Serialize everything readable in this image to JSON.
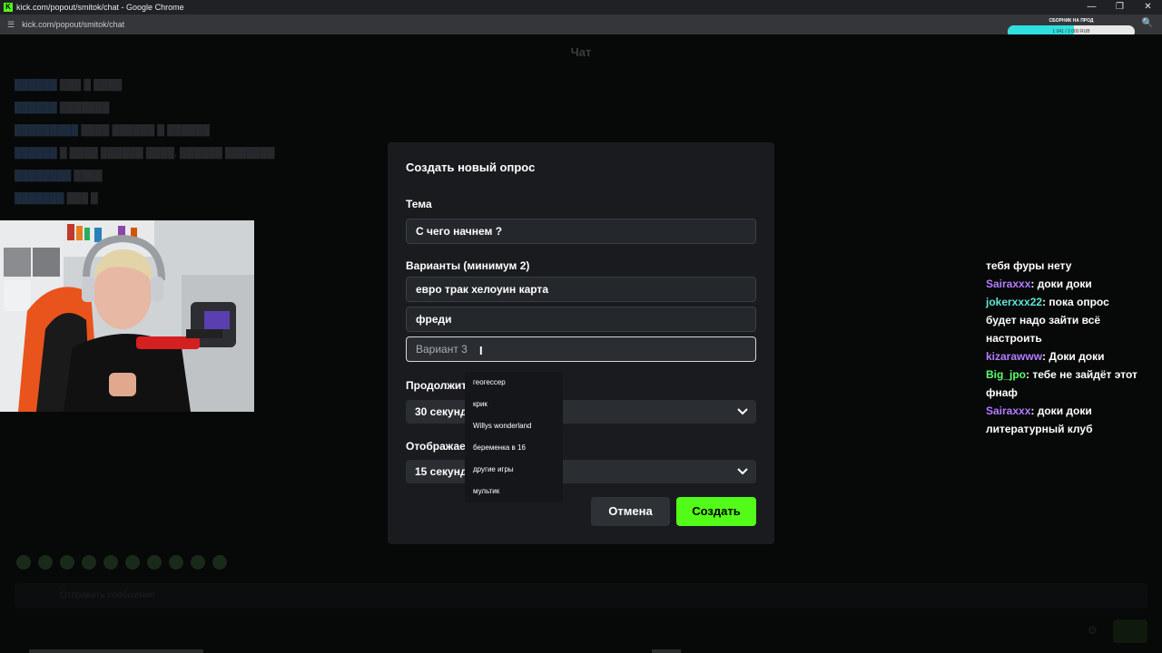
{
  "browser": {
    "window_title": "kick.com/popout/smitok/chat - Google Chrome",
    "url": "kick.com/popout/smitok/chat",
    "favicon_letter": "K"
  },
  "donation": {
    "label": "СБОРНИК НА ПРОД",
    "amount_text": "1 041 / 2 000 RUB",
    "progress": 0.52
  },
  "chat": {
    "title": "Чат",
    "input_placeholder": "Отправить сообщение"
  },
  "overlay_chat": [
    {
      "user": "",
      "text": "тебя фуры нету",
      "color": ""
    },
    {
      "user": "Sairaxxx",
      "text": "доки доки",
      "color": "purple"
    },
    {
      "user": "jokerxxx22",
      "text": "пока опрос будет надо зайти всё настроить",
      "color": "cyan"
    },
    {
      "user": "kizarawww",
      "text": "Доки доки",
      "color": "purple"
    },
    {
      "user": "Big_jpo",
      "text": "тебе не зайдёт этот фнаф",
      "color": "green"
    },
    {
      "user": "Sairaxxx",
      "text": "доки доки литературный клуб",
      "color": "purple"
    }
  ],
  "poll_modal": {
    "title": "Создать новый опрос",
    "topic_label": "Тема",
    "topic_value": "С чего начнем ?",
    "options_label": "Варианты (минимум 2)",
    "option1_value": "евро трак хелоуин карта",
    "option2_value": "фреди",
    "option3_placeholder": "Вариант 3",
    "duration_label": "Продолжит",
    "duration_value": "30 секунд",
    "display_label": "Отображае",
    "display_value": "15 секунд",
    "cancel_label": "Отмена",
    "create_label": "Создать"
  },
  "suggestions": [
    "геогессер",
    "крик",
    "Willys wonderland",
    "беременка в 16",
    "другие игры",
    "мультик"
  ]
}
